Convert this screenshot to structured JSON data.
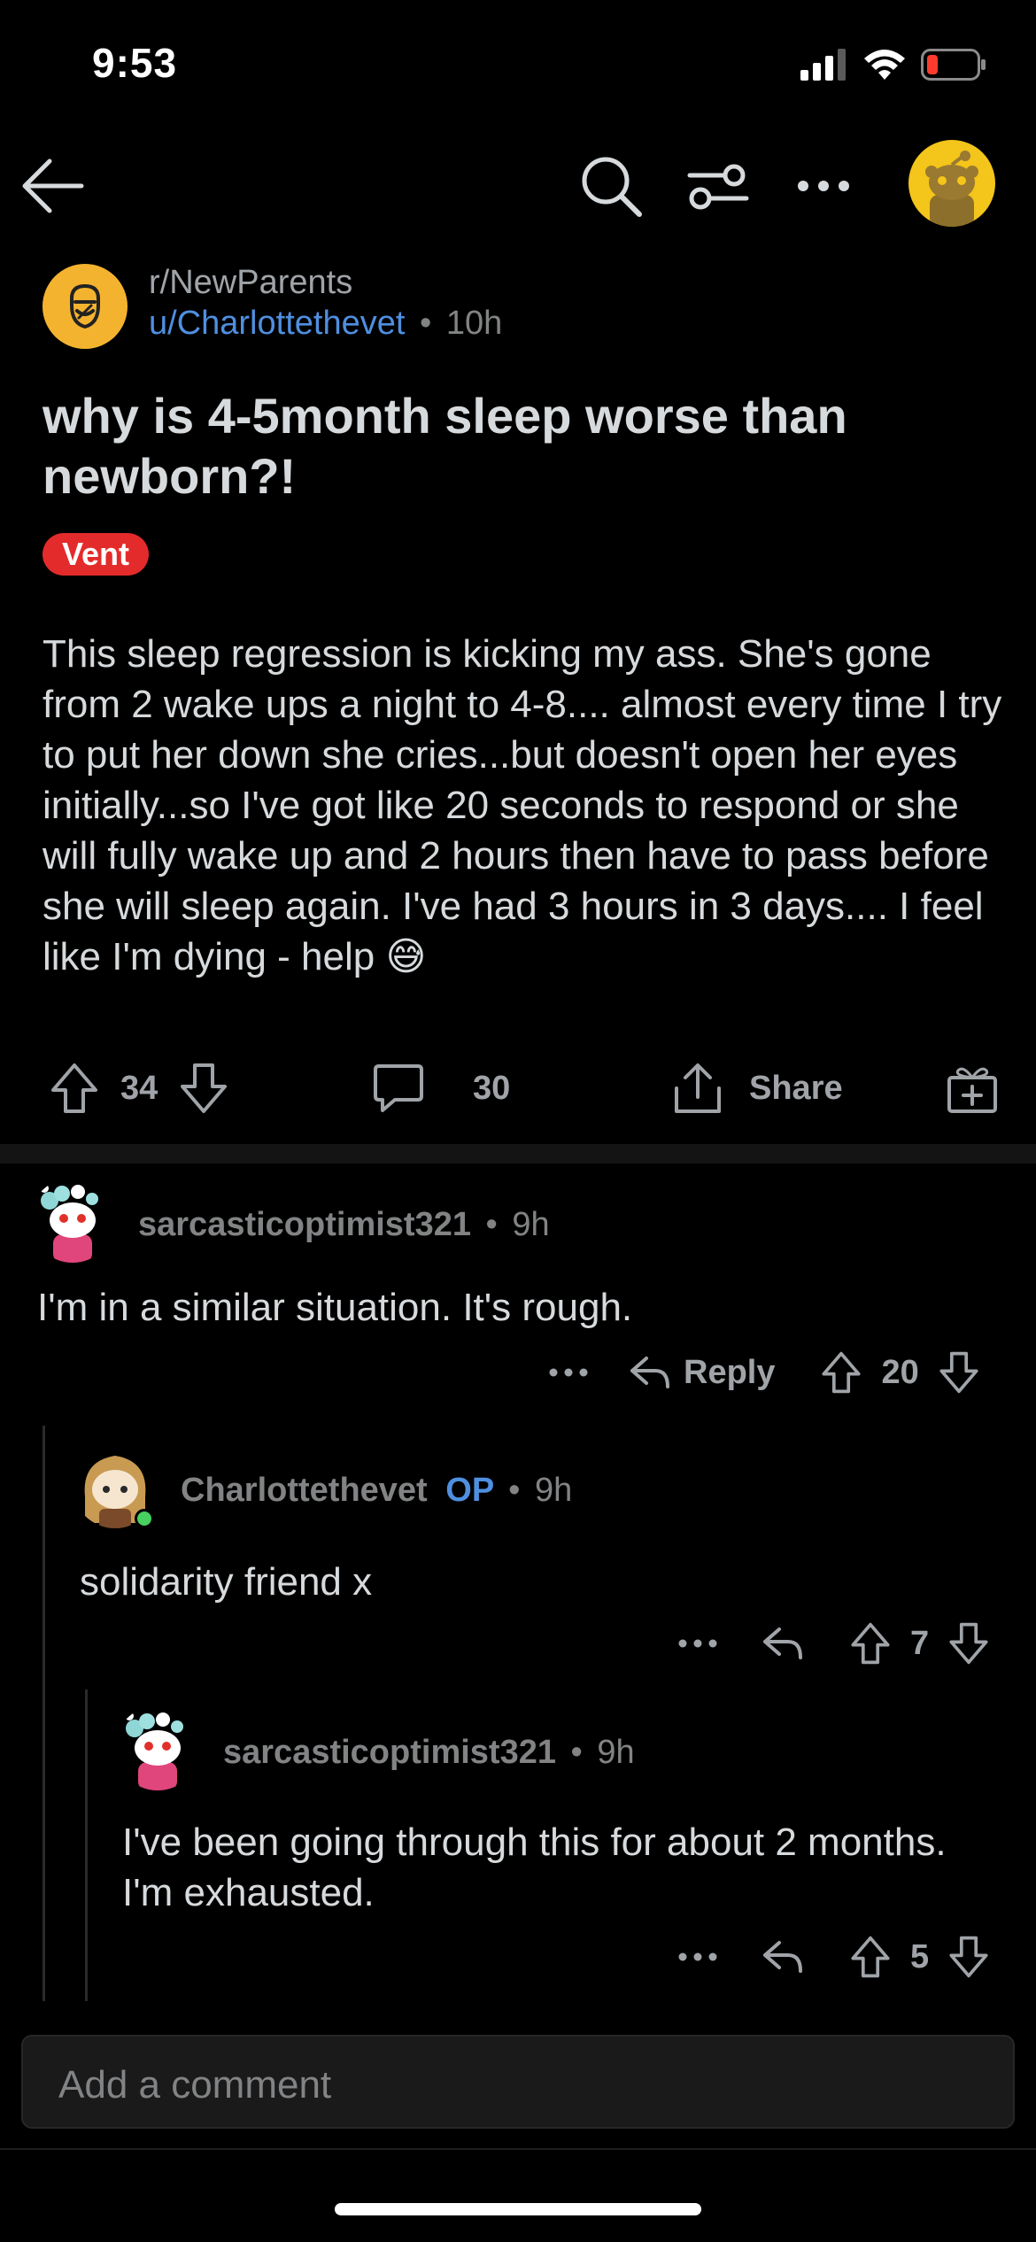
{
  "status_bar": {
    "time": "9:53"
  },
  "post": {
    "subreddit": "r/NewParents",
    "author": "u/Charlottethevet",
    "separator": "•",
    "age": "10h",
    "title": "why is 4-5month sleep worse than newborn?!",
    "flair": "Vent",
    "body": "This sleep regression is kicking my ass. She's gone from 2 wake ups a night to 4-8.... almost every time I try to put her down she cries...but doesn't open her eyes initially...so I've got like 20 seconds to respond or she will fully wake up and 2 hours then have to pass before she will sleep again. I've had 3 hours in 3 days.... I feel like I'm dying - help",
    "emoji": "😅",
    "votes": "34",
    "comments": "30",
    "share_label": "Share"
  },
  "comments": [
    {
      "user": "sarcasticoptimist321",
      "age": "9h",
      "text": "I'm in a similar situation. It's rough.",
      "reply_label": "Reply",
      "votes": "20"
    },
    {
      "user": "Charlottethevet",
      "op_badge": "OP",
      "age": "9h",
      "text": "solidarity friend x",
      "votes": "7"
    },
    {
      "user": "sarcasticoptimist321",
      "age": "9h",
      "text": "I've been going through this for about 2 months. I'm exhausted.",
      "votes": "5"
    }
  ],
  "composer": {
    "placeholder": "Add a comment"
  },
  "colors": {
    "background": "#000000",
    "accent_blue": "#4f8fe0",
    "flair_red": "#e42b2b",
    "subreddit_yellow": "#f4b32f",
    "text_primary": "#d7dadc",
    "text_muted": "#818384"
  },
  "icons": [
    "back-arrow-icon",
    "search-icon",
    "sort-filter-icon",
    "more-icon",
    "profile-avatar-icon",
    "upvote-icon",
    "downvote-icon",
    "comment-icon",
    "share-icon",
    "award-icon",
    "reply-icon"
  ]
}
